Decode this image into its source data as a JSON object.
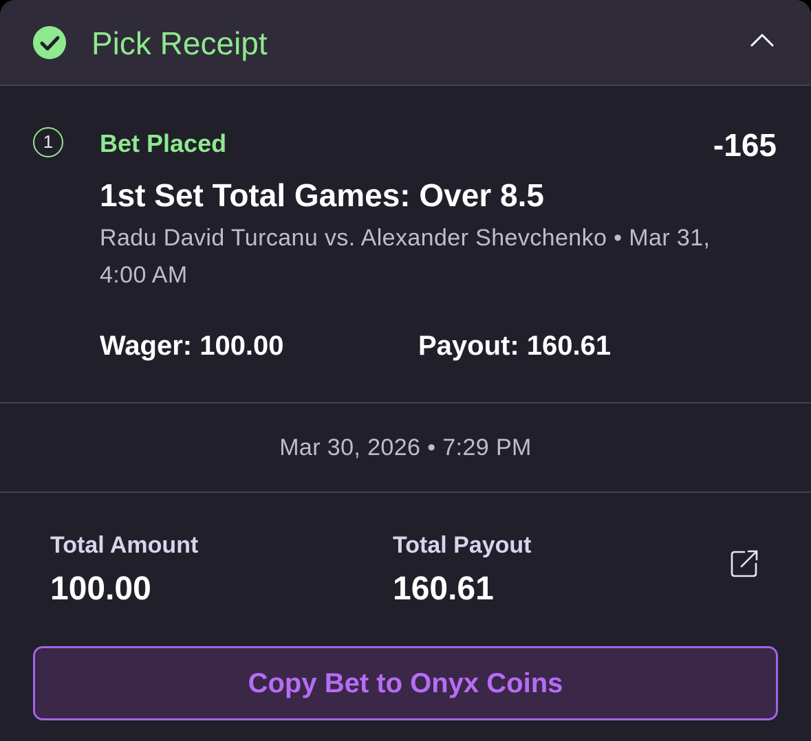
{
  "header": {
    "title": "Pick Receipt",
    "check_icon": "check-circle-icon",
    "collapse_icon": "chevron-up-icon"
  },
  "leg": {
    "number": "1",
    "status": "Bet Placed",
    "odds": "-165",
    "market": "1st Set Total Games: Over 8.5",
    "event": "Radu David Turcanu vs. Alexander Shevchenko • Mar 31, 4:00 AM",
    "wager": "Wager: 100.00",
    "payout": "Payout: 160.61"
  },
  "placed_at": "Mar 30, 2026 • 7:29 PM",
  "totals": {
    "amount_label": "Total Amount",
    "amount_value": "100.00",
    "payout_label": "Total Payout",
    "payout_value": "160.61",
    "share_icon": "external-share-icon"
  },
  "copy_button": {
    "label": "Copy Bet to Onyx Coins"
  },
  "colors": {
    "accent_green": "#8ee98f",
    "accent_purple": "#b66df5",
    "background": "#211f29",
    "header_background": "#302b39"
  }
}
